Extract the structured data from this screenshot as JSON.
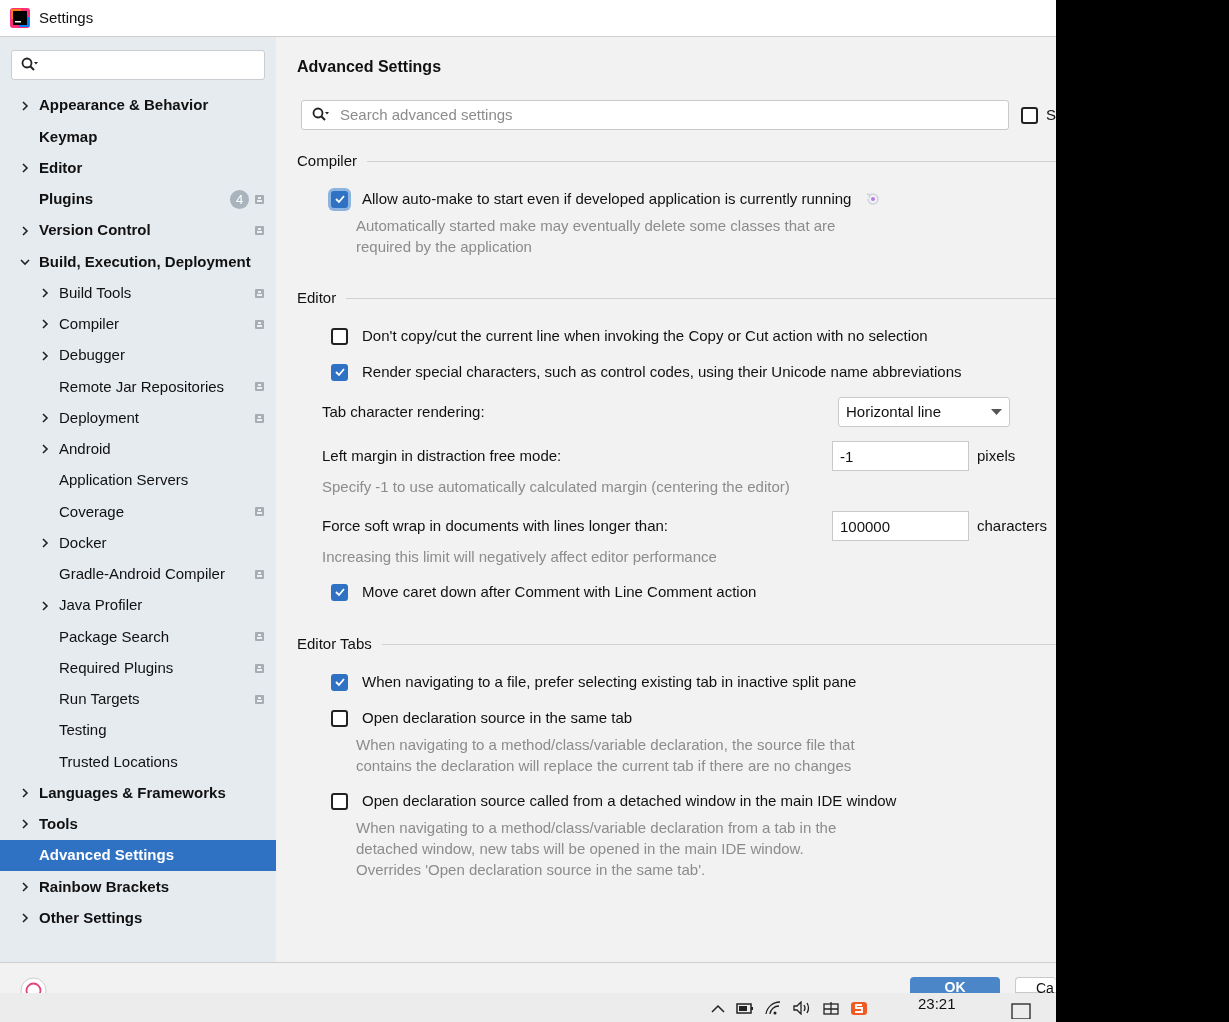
{
  "window": {
    "title": "Settings"
  },
  "sidebar": {
    "items": [
      {
        "label": "Appearance & Behavior",
        "expandable": true,
        "expanded": false,
        "selected": false,
        "project_scope": false
      },
      {
        "label": "Keymap",
        "expandable": false,
        "expanded": false,
        "selected": false,
        "project_scope": false
      },
      {
        "label": "Editor",
        "expandable": true,
        "expanded": false,
        "selected": false,
        "project_scope": false
      },
      {
        "label": "Plugins",
        "expandable": false,
        "expanded": false,
        "selected": false,
        "project_scope": true,
        "badge": "4"
      },
      {
        "label": "Version Control",
        "expandable": true,
        "expanded": false,
        "selected": false,
        "project_scope": true
      },
      {
        "label": "Build, Execution, Deployment",
        "expandable": true,
        "expanded": true,
        "selected": false,
        "project_scope": false,
        "children": [
          {
            "label": "Build Tools",
            "expandable": true,
            "expanded": false,
            "selected": false,
            "project_scope": true
          },
          {
            "label": "Compiler",
            "expandable": true,
            "expanded": false,
            "selected": false,
            "project_scope": true
          },
          {
            "label": "Debugger",
            "expandable": true,
            "expanded": false,
            "selected": false,
            "project_scope": false
          },
          {
            "label": "Remote Jar Repositories",
            "expandable": false,
            "expanded": false,
            "selected": false,
            "project_scope": true
          },
          {
            "label": "Deployment",
            "expandable": true,
            "expanded": false,
            "selected": false,
            "project_scope": true
          },
          {
            "label": "Android",
            "expandable": true,
            "expanded": false,
            "selected": false,
            "project_scope": false
          },
          {
            "label": "Application Servers",
            "expandable": false,
            "expanded": false,
            "selected": false,
            "project_scope": false
          },
          {
            "label": "Coverage",
            "expandable": false,
            "expanded": false,
            "selected": false,
            "project_scope": true
          },
          {
            "label": "Docker",
            "expandable": true,
            "expanded": false,
            "selected": false,
            "project_scope": false
          },
          {
            "label": "Gradle-Android Compiler",
            "expandable": false,
            "expanded": false,
            "selected": false,
            "project_scope": true
          },
          {
            "label": "Java Profiler",
            "expandable": true,
            "expanded": false,
            "selected": false,
            "project_scope": false
          },
          {
            "label": "Package Search",
            "expandable": false,
            "expanded": false,
            "selected": false,
            "project_scope": true
          },
          {
            "label": "Required Plugins",
            "expandable": false,
            "expanded": false,
            "selected": false,
            "project_scope": true
          },
          {
            "label": "Run Targets",
            "expandable": false,
            "expanded": false,
            "selected": false,
            "project_scope": true
          },
          {
            "label": "Testing",
            "expandable": false,
            "expanded": false,
            "selected": false,
            "project_scope": false
          },
          {
            "label": "Trusted Locations",
            "expandable": false,
            "expanded": false,
            "selected": false,
            "project_scope": false
          }
        ]
      },
      {
        "label": "Languages & Frameworks",
        "expandable": true,
        "expanded": false,
        "selected": false,
        "project_scope": false
      },
      {
        "label": "Tools",
        "expandable": true,
        "expanded": false,
        "selected": false,
        "project_scope": false
      },
      {
        "label": "Advanced Settings",
        "expandable": false,
        "expanded": false,
        "selected": true,
        "project_scope": false
      },
      {
        "label": "Rainbow Brackets",
        "expandable": true,
        "expanded": false,
        "selected": false,
        "project_scope": false
      },
      {
        "label": "Other Settings",
        "expandable": true,
        "expanded": false,
        "selected": false,
        "project_scope": false
      }
    ]
  },
  "content": {
    "title": "Advanced Settings",
    "search": {
      "placeholder": "Search advanced settings"
    },
    "filter_checkbox": {
      "label": "S",
      "checked": false
    },
    "sections": [
      {
        "title": "Compiler",
        "rows": [
          {
            "kind": "checkbox",
            "label": "Allow auto-make to start even if developed application is currently running",
            "checked": true,
            "focused": true,
            "modified": true,
            "description": "Automatically started make may eventually delete some classes that are required by the application"
          }
        ]
      },
      {
        "title": "Editor",
        "rows": [
          {
            "kind": "checkbox",
            "label": "Don't copy/cut the current line when invoking the Copy or Cut action with no selection",
            "checked": false,
            "focused": false,
            "modified": false
          },
          {
            "kind": "checkbox",
            "label": "Render special characters, such as control codes, using their Unicode name abbreviations",
            "checked": true,
            "focused": false,
            "modified": false
          },
          {
            "kind": "select",
            "label": "Tab character rendering:",
            "value": "Horizontal line"
          },
          {
            "kind": "number",
            "label": "Left margin in distraction free mode:",
            "value": "-1",
            "unit": "pixels",
            "description": "Specify -1 to use automatically calculated margin (centering the editor)"
          },
          {
            "kind": "number",
            "label": "Force soft wrap in documents with lines longer than:",
            "value": "100000",
            "unit": "characters",
            "description": "Increasing this limit will negatively affect editor performance"
          },
          {
            "kind": "checkbox",
            "label": "Move caret down after Comment with Line Comment action",
            "checked": true,
            "focused": false,
            "modified": false
          }
        ]
      },
      {
        "title": "Editor Tabs",
        "rows": [
          {
            "kind": "checkbox",
            "label": "When navigating to a file, prefer selecting existing tab in inactive split pane",
            "checked": true,
            "focused": false,
            "modified": false
          },
          {
            "kind": "checkbox",
            "label": "Open declaration source in the same tab",
            "checked": false,
            "focused": false,
            "modified": false,
            "description": "When navigating to a method/class/variable declaration, the source file that contains the declaration will replace the current tab if there are no changes"
          },
          {
            "kind": "checkbox",
            "label": "Open declaration source called from a detached window in the main IDE window",
            "checked": false,
            "focused": false,
            "modified": false,
            "description": "When navigating to a method/class/variable declaration from a tab in the detached window, new tabs will be opened in the main IDE window. Overrides 'Open declaration source in the same tab'."
          }
        ]
      }
    ]
  },
  "footer": {
    "buttons": [
      {
        "label": "OK",
        "primary": true
      },
      {
        "label": "Ca",
        "primary": false
      }
    ]
  },
  "taskbar": {
    "time": "23:21"
  }
}
